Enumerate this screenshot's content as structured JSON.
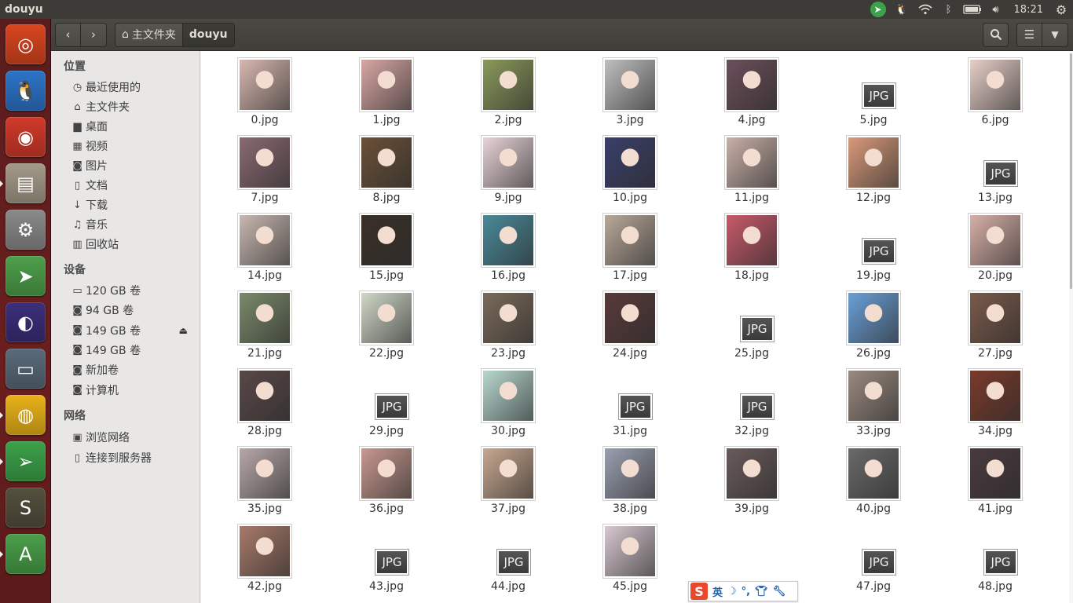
{
  "window": {
    "title": "douyu"
  },
  "panel": {
    "indicators": [
      "telegram-icon",
      "qq-penguin-icon",
      "wifi-icon",
      "bluetooth-icon",
      "battery-icon",
      "volume-icon"
    ],
    "clock": "18:21"
  },
  "launcher": [
    {
      "name": "ubuntu-dash",
      "icon": "ubuntu-logo-icon",
      "color": "#d9461f",
      "glyph": "◎"
    },
    {
      "name": "qq",
      "icon": "qq-penguin-icon",
      "color": "#2d74c8",
      "glyph": "🐧"
    },
    {
      "name": "netease-music",
      "icon": "netease-music-icon",
      "color": "#d23a2a",
      "glyph": "◉"
    },
    {
      "name": "files",
      "icon": "file-cabinet-icon",
      "color": "#a59a8a",
      "glyph": "▤"
    },
    {
      "name": "system-settings",
      "icon": "gear-wrench-icon",
      "color": "#8a8a8a",
      "glyph": "⚙"
    },
    {
      "name": "software-updater",
      "icon": "update-arrow-icon",
      "color": "#4ea04b",
      "glyph": "➤"
    },
    {
      "name": "eclipse",
      "icon": "eclipse-icon",
      "color": "#3b2f7a",
      "glyph": "◐"
    },
    {
      "name": "remote-desktop",
      "icon": "computer-icon",
      "color": "#5a6b7a",
      "glyph": "▭"
    },
    {
      "name": "chrome",
      "icon": "chrome-icon",
      "color": "#e8b21a",
      "glyph": "◍"
    },
    {
      "name": "telegram",
      "icon": "paper-plane-icon",
      "color": "#3ca24a",
      "glyph": "➢"
    },
    {
      "name": "sublime-text",
      "icon": "sublime-icon",
      "color": "#55503e",
      "glyph": "S"
    },
    {
      "name": "software-center",
      "icon": "software-center-icon",
      "color": "#4a9f4a",
      "glyph": "A"
    }
  ],
  "nav": {
    "back": "‹",
    "forward": "›"
  },
  "breadcrumb": {
    "home_label": "主文件夹",
    "current": "douyu"
  },
  "sidebar": {
    "places_heading": "位置",
    "places": [
      {
        "label": "最近使用的",
        "icon": "clock-icon",
        "glyph": "◷"
      },
      {
        "label": "主文件夹",
        "icon": "home-icon",
        "glyph": "⌂"
      },
      {
        "label": "桌面",
        "icon": "folder-icon",
        "glyph": "▆"
      },
      {
        "label": "视频",
        "icon": "film-icon",
        "glyph": "▦"
      },
      {
        "label": "图片",
        "icon": "camera-icon",
        "glyph": "◙"
      },
      {
        "label": "文档",
        "icon": "document-icon",
        "glyph": "▯"
      },
      {
        "label": "下载",
        "icon": "download-icon",
        "glyph": "↓"
      },
      {
        "label": "音乐",
        "icon": "music-icon",
        "glyph": "♫"
      },
      {
        "label": "回收站",
        "icon": "trash-icon",
        "glyph": "▥"
      }
    ],
    "devices_heading": "设备",
    "devices": [
      {
        "label": "120 GB 卷",
        "icon": "drive-icon",
        "glyph": "▭"
      },
      {
        "label": "94 GB 卷",
        "icon": "drive-icon",
        "glyph": "◙"
      },
      {
        "label": "149 GB 卷",
        "icon": "drive-icon",
        "glyph": "◙",
        "eject": true
      },
      {
        "label": "149 GB 卷",
        "icon": "drive-icon",
        "glyph": "◙"
      },
      {
        "label": "新加卷",
        "icon": "drive-icon",
        "glyph": "◙"
      },
      {
        "label": "计算机",
        "icon": "drive-icon",
        "glyph": "◙"
      }
    ],
    "network_heading": "网络",
    "network": [
      {
        "label": "浏览网络",
        "icon": "network-icon",
        "glyph": "▣"
      },
      {
        "label": "连接到服务器",
        "icon": "server-icon",
        "glyph": "▯"
      }
    ]
  },
  "files": [
    {
      "name": "0.jpg",
      "thumb": true,
      "color": "#d9b8b0"
    },
    {
      "name": "1.jpg",
      "thumb": true,
      "color": "#d8a7a4"
    },
    {
      "name": "2.jpg",
      "thumb": true,
      "color": "#8a9a5a"
    },
    {
      "name": "3.jpg",
      "thumb": true,
      "color": "#bfbfbf"
    },
    {
      "name": "4.jpg",
      "thumb": true,
      "color": "#6b4f5a"
    },
    {
      "name": "5.jpg",
      "thumb": false,
      "color": ""
    },
    {
      "name": "6.jpg",
      "thumb": true,
      "color": "#e8d0c8"
    },
    {
      "name": "7.jpg",
      "thumb": true,
      "color": "#8a6a72"
    },
    {
      "name": "8.jpg",
      "thumb": true,
      "color": "#6a5038"
    },
    {
      "name": "9.jpg",
      "thumb": true,
      "color": "#e8d4d8"
    },
    {
      "name": "10.jpg",
      "thumb": true,
      "color": "#3a3f6a"
    },
    {
      "name": "11.jpg",
      "thumb": true,
      "color": "#c8b0a8"
    },
    {
      "name": "12.jpg",
      "thumb": true,
      "color": "#d89a7a"
    },
    {
      "name": "13.jpg",
      "thumb": false,
      "color": ""
    },
    {
      "name": "14.jpg",
      "thumb": true,
      "color": "#c8b8b0"
    },
    {
      "name": "15.jpg",
      "thumb": true,
      "color": "#3a3028"
    },
    {
      "name": "16.jpg",
      "thumb": true,
      "color": "#4a8a9a"
    },
    {
      "name": "17.jpg",
      "thumb": true,
      "color": "#b8a89a"
    },
    {
      "name": "18.jpg",
      "thumb": true,
      "color": "#c85a6a"
    },
    {
      "name": "19.jpg",
      "thumb": false,
      "color": ""
    },
    {
      "name": "20.jpg",
      "thumb": true,
      "color": "#d8b0a8"
    },
    {
      "name": "21.jpg",
      "thumb": true,
      "color": "#7a8a6a"
    },
    {
      "name": "22.jpg",
      "thumb": true,
      "color": "#d0d8c8"
    },
    {
      "name": "23.jpg",
      "thumb": true,
      "color": "#7a6a5a"
    },
    {
      "name": "24.jpg",
      "thumb": true,
      "color": "#5a3a3a"
    },
    {
      "name": "25.jpg",
      "thumb": false,
      "color": ""
    },
    {
      "name": "26.jpg",
      "thumb": true,
      "color": "#6aa0d8"
    },
    {
      "name": "27.jpg",
      "thumb": true,
      "color": "#7a5a4a"
    },
    {
      "name": "28.jpg",
      "thumb": true,
      "color": "#5a4848"
    },
    {
      "name": "29.jpg",
      "thumb": false,
      "color": ""
    },
    {
      "name": "30.jpg",
      "thumb": true,
      "color": "#b8d8d0"
    },
    {
      "name": "31.jpg",
      "thumb": false,
      "color": ""
    },
    {
      "name": "32.jpg",
      "thumb": false,
      "color": ""
    },
    {
      "name": "33.jpg",
      "thumb": true,
      "color": "#9a8a80"
    },
    {
      "name": "34.jpg",
      "thumb": true,
      "color": "#7a3a2a"
    },
    {
      "name": "35.jpg",
      "thumb": true,
      "color": "#b8a8a8"
    },
    {
      "name": "36.jpg",
      "thumb": true,
      "color": "#c89890"
    },
    {
      "name": "37.jpg",
      "thumb": true,
      "color": "#c8a890"
    },
    {
      "name": "38.jpg",
      "thumb": true,
      "color": "#9aa0b0"
    },
    {
      "name": "39.jpg",
      "thumb": true,
      "color": "#6a5a5a"
    },
    {
      "name": "40.jpg",
      "thumb": true,
      "color": "#6a6a6a"
    },
    {
      "name": "41.jpg",
      "thumb": true,
      "color": "#4a3a40"
    },
    {
      "name": "42.jpg",
      "thumb": true,
      "color": "#a87a6a"
    },
    {
      "name": "43.jpg",
      "thumb": false,
      "color": ""
    },
    {
      "name": "44.jpg",
      "thumb": false,
      "color": ""
    },
    {
      "name": "45.jpg",
      "thumb": true,
      "color": "#d8c8d0"
    },
    {
      "name": "",
      "thumb": false,
      "color": "",
      "hidden": true
    },
    {
      "name": "47.jpg",
      "thumb": false,
      "color": ""
    },
    {
      "name": "48.jpg",
      "thumb": false,
      "color": ""
    }
  ],
  "generic_label": "JPG",
  "ime": {
    "mode": "英",
    "icons": [
      "moon-icon",
      "punctuation-icon",
      "shirt-icon",
      "wrench-icon"
    ]
  }
}
